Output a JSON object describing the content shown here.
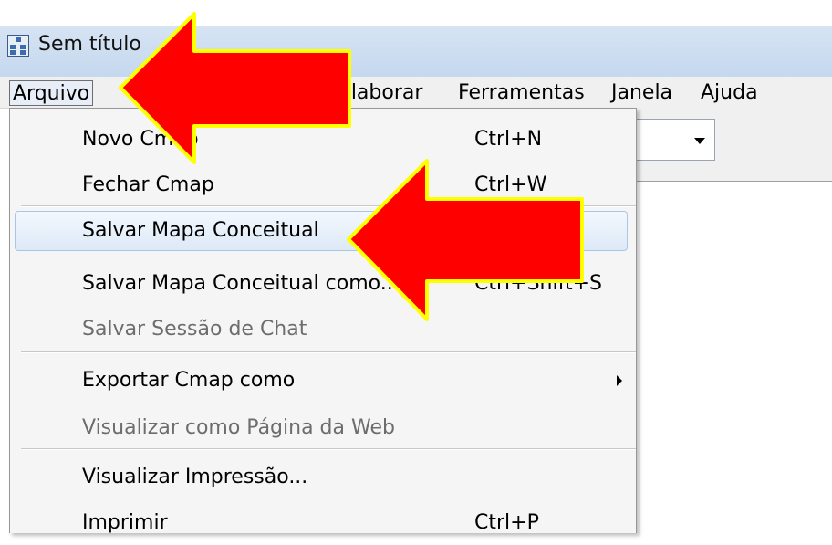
{
  "window": {
    "title": "Sem título"
  },
  "menubar": {
    "items": [
      {
        "label": "Arquivo",
        "active": true
      },
      {
        "label": "Colaborar"
      },
      {
        "label": "Ferramentas"
      },
      {
        "label": "Janela"
      },
      {
        "label": "Ajuda"
      }
    ]
  },
  "dropdown": {
    "items": [
      {
        "label": "Novo Cmap",
        "shortcut": "Ctrl+N"
      },
      {
        "label": "Fechar Cmap",
        "shortcut": "Ctrl+W"
      },
      {
        "label": "Salvar Mapa Conceitual",
        "shortcut": "",
        "highlighted": true
      },
      {
        "label": "Salvar Mapa Conceitual como...",
        "shortcut": "Ctrl+Shift+S"
      },
      {
        "label": "Salvar Sessão de Chat",
        "disabled": true
      },
      {
        "label": "Exportar Cmap como",
        "submenu": true
      },
      {
        "label": "Visualizar como Página da Web",
        "disabled": true
      },
      {
        "label": "Visualizar Impressão..."
      },
      {
        "label": "Imprimir",
        "shortcut": "Ctrl+P"
      }
    ]
  },
  "annotation": {
    "arrow_fill": "#ff0000",
    "arrow_outline": "#ffff00"
  },
  "colors": {
    "titlebar": "#c9dbef",
    "menubar": "#f0f0f0",
    "highlight_border": "#a8c6e8"
  }
}
